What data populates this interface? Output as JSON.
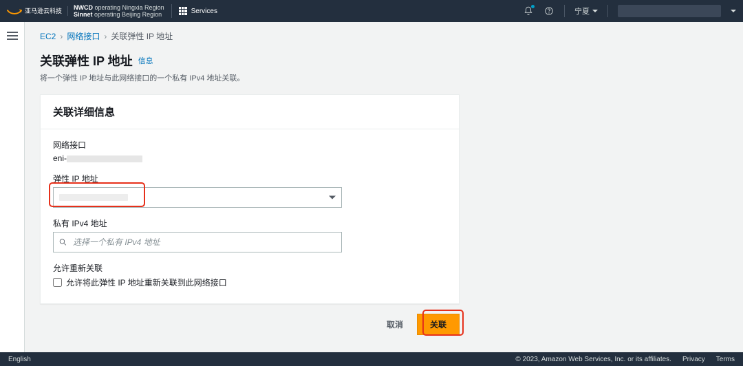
{
  "topnav": {
    "brand_cn": "亚马逊云科技",
    "operator_line1_b": "NWCD",
    "operator_line1": " operating Ningxia Region",
    "operator_line2_b": "Sinnet",
    "operator_line2": " operating Beijing Region",
    "services": "Services",
    "region": "宁夏"
  },
  "breadcrumbs": {
    "ec2": "EC2",
    "ni": "网络接口",
    "current": "关联弹性 IP 地址"
  },
  "page": {
    "title": "关联弹性 IP 地址",
    "info": "信息",
    "subtitle": "将一个弹性 IP 地址与此网络接口的一个私有 IPv4 地址关联。"
  },
  "panel": {
    "header": "关联详细信息",
    "ni_label": "网络接口",
    "ni_value_prefix": "eni-",
    "eip_label": "弹性 IP 地址",
    "priv_label": "私有 IPv4 地址",
    "priv_placeholder": "选择一个私有 IPv4 地址",
    "reassoc_label": "允许重新关联",
    "reassoc_checkbox": "允许将此弹性 IP 地址重新关联到此网络接口"
  },
  "actions": {
    "cancel": "取消",
    "associate": "关联"
  },
  "footer": {
    "lang": "English",
    "copyright": "© 2023, Amazon Web Services, Inc. or its affiliates.",
    "privacy": "Privacy",
    "terms": "Terms"
  }
}
